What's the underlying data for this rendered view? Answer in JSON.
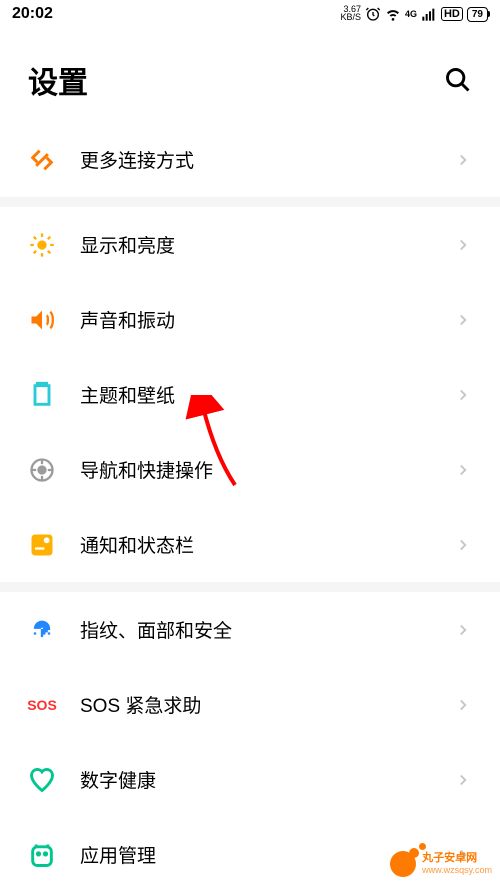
{
  "status_bar": {
    "time": "20:02",
    "kbs": "3.67",
    "kbs_unit": "KB/S",
    "network_type": "4G",
    "hd": "HD",
    "battery": "79"
  },
  "header": {
    "title": "设置"
  },
  "groups": [
    {
      "items": [
        {
          "icon": "connect",
          "color": "#ff7a00",
          "label": "更多连接方式",
          "name": "more-connections"
        }
      ]
    },
    {
      "items": [
        {
          "icon": "brightness",
          "color": "#ffb000",
          "label": "显示和亮度",
          "name": "display-brightness"
        },
        {
          "icon": "sound",
          "color": "#ff7a00",
          "label": "声音和振动",
          "name": "sound-vibration"
        },
        {
          "icon": "theme",
          "color": "#2bcbd6",
          "label": "主题和壁纸",
          "name": "theme-wallpaper"
        },
        {
          "icon": "nav",
          "color": "#9b9b9b",
          "label": "导航和快捷操作",
          "name": "navigation-shortcut"
        },
        {
          "icon": "notify",
          "color": "#ffb000",
          "label": "通知和状态栏",
          "name": "notification-statusbar"
        }
      ]
    },
    {
      "items": [
        {
          "icon": "fingerprint",
          "color": "#2188ff",
          "label": "指纹、面部和安全",
          "name": "fingerprint-face-security"
        },
        {
          "icon": "sos",
          "color": "#ff3030",
          "label": "SOS 紧急求助",
          "name": "sos-emergency"
        },
        {
          "icon": "health",
          "color": "#00c58e",
          "label": "数字健康",
          "name": "digital-health"
        },
        {
          "icon": "apps",
          "color": "#00c58e",
          "label": "应用管理",
          "name": "app-management"
        }
      ]
    }
  ],
  "watermark": {
    "text": "丸子安卓网",
    "url": "www.wzsqsy.com"
  },
  "icons": {
    "connect": "connect-icon",
    "brightness": "brightness-icon",
    "sound": "sound-icon",
    "theme": "theme-icon",
    "nav": "nav-icon",
    "notify": "notify-icon",
    "fingerprint": "fingerprint-icon",
    "sos": "sos-icon",
    "health": "health-icon",
    "apps": "apps-icon"
  }
}
